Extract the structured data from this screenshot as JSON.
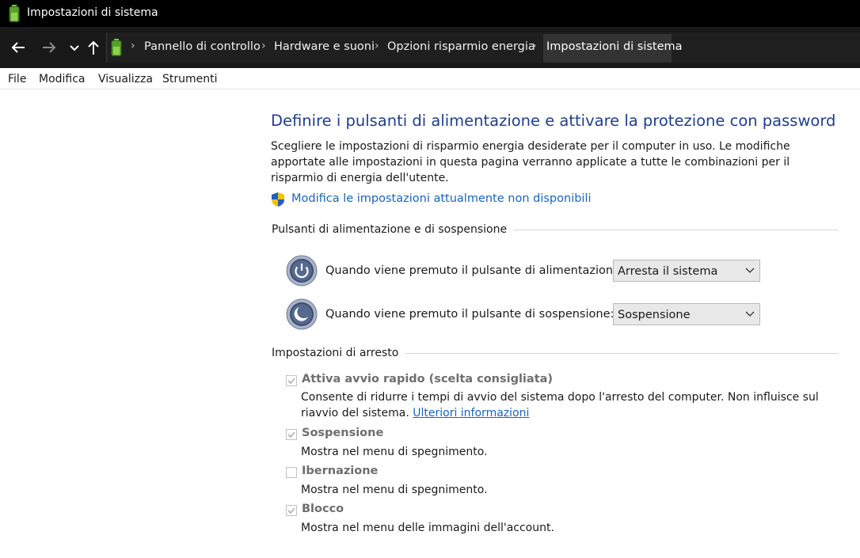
{
  "window": {
    "title": "Impostazioni di sistema"
  },
  "breadcrumb": {
    "items": [
      "Pannello di controllo",
      "Hardware e suoni",
      "Opzioni risparmio energia",
      "Impostazioni di sistema"
    ]
  },
  "menu": {
    "items": [
      "File",
      "Modifica",
      "Visualizza",
      "Strumenti"
    ]
  },
  "main": {
    "heading": "Definire i pulsanti di alimentazione e attivare la protezione con password",
    "description": "Scegliere le impostazioni di risparmio energia desiderate per il computer in uso. Le modifiche apportate alle impostazioni in questa pagina verranno applicate a tutte le combinazioni per il risparmio di energia dell'utente.",
    "admin_link": "Modifica le impostazioni attualmente non disponibili",
    "power_section": {
      "title": "Pulsanti di alimentazione e di sospensione",
      "rows": [
        {
          "label": "Quando viene premuto il pulsante di alimentazione:",
          "value": "Arresta il sistema"
        },
        {
          "label": "Quando viene premuto il pulsante di sospensione:",
          "value": "Sospensione"
        }
      ]
    },
    "shutdown_section": {
      "title": "Impostazioni di arresto",
      "options": [
        {
          "title": "Attiva avvio rapido (scelta consigliata)",
          "checked": true,
          "desc": "Consente di ridurre i tempi di avvio del sistema dopo l'arresto del computer. Non influisce sul riavvio del sistema.",
          "link": "Ulteriori informazioni"
        },
        {
          "title": "Sospensione",
          "checked": true,
          "desc": "Mostra nel menu di spegnimento."
        },
        {
          "title": "Ibernazione",
          "checked": false,
          "desc": "Mostra nel menu di spegnimento."
        },
        {
          "title": "Blocco",
          "checked": true,
          "desc": "Mostra nel menu delle immagini dell'account."
        }
      ]
    }
  },
  "colors": {
    "heading": "#1e3f8f",
    "link": "#1665c0",
    "titlebar": "#000000",
    "addressbar": "#191919"
  },
  "icons": [
    "battery-icon",
    "back-arrow-icon",
    "forward-arrow-icon",
    "recent-locations-chevron-icon",
    "up-arrow-icon",
    "uac-shield-icon",
    "power-button-icon",
    "sleep-button-icon",
    "checkmark-icon",
    "chevron-down-icon"
  ]
}
